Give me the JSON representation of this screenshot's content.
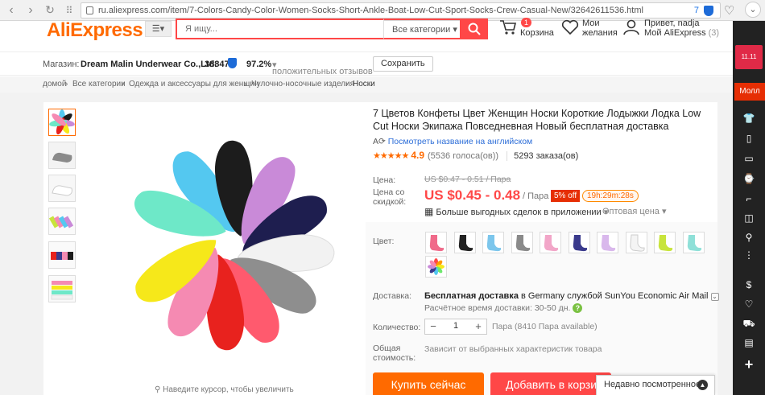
{
  "browser": {
    "url": "ru.aliexpress.com/item/7-Colors-Candy-Color-Women-Socks-Short-Ankle-Boat-Low-Cut-Sport-Socks-Crew-Casual-New/32642611536.html",
    "badge_count": "7"
  },
  "header": {
    "logo": "AliExpress",
    "search_placeholder": "Я ищу...",
    "category": "Все категории",
    "cart_count": "1",
    "cart_label": "Корзина",
    "wish_line1": "Мои",
    "wish_line2": "желания",
    "greeting": "Привет, nadja",
    "my_account": "Мой AliExpress",
    "my_account_count": "(3)"
  },
  "store": {
    "label": "Магазин:",
    "name": "Dream Malin Underwear Co.,Ltd.",
    "score": "38847",
    "positive": "97.2%",
    "positive_label": "положительных отзывов",
    "save": "Сохранить"
  },
  "breadcrumb": [
    "домой",
    "Все категории",
    "Одежда и аксессуары для женщин",
    "Чулочно-носочные изделия",
    "Носки"
  ],
  "product": {
    "title": "7 Цветов Конфеты Цвет Женщин Носки Короткие Лодыжки Лодка Low Cut Носки Экипажа Повседневная Новый бесплатная доставка",
    "translate_link": "Посмотреть название на английском",
    "rating": "4.9",
    "votes": "(5536 голоса(ов))",
    "orders": "5293 заказа(ов)",
    "price_label": "Цена:",
    "old_price": "US $0.47 - 0.51 / Пара",
    "discount_label_1": "Цена со",
    "discount_label_2": "скидкой:",
    "price": "US $0.45 - 0.48",
    "per": "/ Пара",
    "discount": "5% off",
    "timer": "19h:29m:28s",
    "app_deals": "Больше выгодных сделок в приложении",
    "wholesale": "Оптовая цена",
    "zoom_hint": "Наведите курсор, чтобы увеличить",
    "color_label": "Цвет:",
    "shipping_label": "Доставка:",
    "shipping_free": "Бесплатная доставка",
    "shipping_rest": " в Germany службой SunYou Economic Air Mail",
    "delivery_time": "Расчётное время доставки: 30-50 дн.",
    "qty_label": "Количество:",
    "qty": "1",
    "qty_available": "Пара (8410 Пара available)",
    "total_label_1": "Общая",
    "total_label_2": "стоимость:",
    "total_value": "Зависит от выбранных характеристик товара",
    "buy_now": "Купить сейчас",
    "add_to_cart": "Добавить в корзину"
  },
  "recently_viewed": "Недавно посмотренное",
  "sidebar": {
    "mall_top": "11.11",
    "mall": "Молл"
  },
  "colors": {
    "accent": "#ff6a00",
    "red": "#ff4747",
    "swatches": [
      "#f06a8a",
      "#222222",
      "#7cc6ec",
      "#8a8a8a",
      "#f2a6c8",
      "#3a3a8c",
      "#d9b8ec",
      "#f4f4f4",
      "#c8e43c",
      "#8fe0d8"
    ],
    "socks": [
      "#54c8f0",
      "#1c1c1c",
      "#c98ad8",
      "#1e1e4f",
      "#f2f2f2",
      "#8e8e8e",
      "#ff5a6e",
      "#e8221e",
      "#f58ab2",
      "#f6e81a",
      "#6ee8c8"
    ]
  }
}
